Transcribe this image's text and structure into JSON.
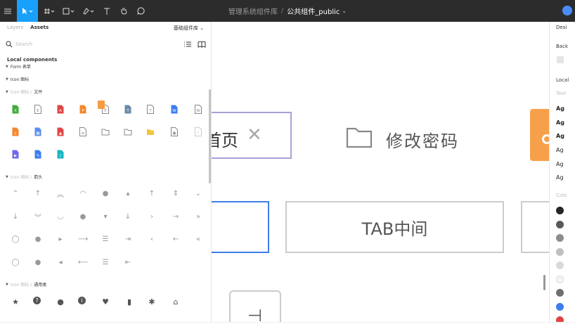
{
  "toolbar": {
    "file_path": "管理系统组件库",
    "separator": "/",
    "file_name": "公共组件_public",
    "file_chevron": "⌄",
    "tools": [
      "menu-icon",
      "move-icon",
      "frame-icon",
      "shape-icon",
      "pen-icon",
      "text-icon",
      "hand-icon",
      "comment-icon"
    ],
    "accent": "#18a0fb"
  },
  "left_panel": {
    "tabs": [
      "Layers",
      "Assets"
    ],
    "active_tab": "Assets",
    "library_selector": "基础组件库 ⌄",
    "search_placeholder": "Search",
    "section_title": "Local components",
    "groups": {
      "form": "Form 表单",
      "icon": "Icon 图标",
      "file_prefix": "Icon 图标 /",
      "file_name": "文件",
      "arrow_prefix": "Icon 图标 /",
      "arrow_name": "箭头",
      "common_prefix": "Icon 图标 /",
      "common_name": "通用类"
    },
    "file_icons": [
      {
        "name": "excel-file-icon",
        "color": "#3dae39",
        "letter": "X"
      },
      {
        "name": "generic-doc-file-icon",
        "color": "#888888",
        "letter": "E"
      },
      {
        "name": "pdf-file-icon",
        "color": "#e04545",
        "letter": "A"
      },
      {
        "name": "ppt-file-icon",
        "color": "#f5872d",
        "letter": "P"
      },
      {
        "name": "ppt-outline-file-icon",
        "color": "#888888",
        "letter": "P"
      },
      {
        "name": "text-file-icon",
        "color": "#6c8aa6",
        "letter": "T"
      },
      {
        "name": "text-outline-file-icon",
        "color": "#888888",
        "letter": "T"
      },
      {
        "name": "word-file-icon",
        "color": "#3c7ef0",
        "letter": "W"
      },
      {
        "name": "word-outline-file-icon",
        "color": "#888888",
        "letter": "W"
      },
      {
        "name": "download-file-icon",
        "color": "#f5872d",
        "letter": "↓"
      },
      {
        "name": "zip-file-icon",
        "color": "#5b8def",
        "letter": "▦"
      },
      {
        "name": "image-file-icon",
        "color": "#e04545",
        "letter": "▲"
      },
      {
        "name": "document-outline-icon",
        "color": "#888888",
        "letter": "≡"
      },
      {
        "name": "folder-outline-icon",
        "color": "#888888",
        "letter": ""
      },
      {
        "name": "folder-open-icon",
        "color": "#888888",
        "letter": ""
      },
      {
        "name": "folder-filled-icon",
        "color": "#f7c33d",
        "letter": ""
      },
      {
        "name": "image-outline-file-icon",
        "color": "#888888",
        "letter": "▣"
      },
      {
        "name": "unknown-file-icon",
        "color": "#cccccc",
        "letter": "?"
      },
      {
        "name": "video-file-icon",
        "color": "#6b6bf0",
        "letter": "▶"
      },
      {
        "name": "edit-file-icon",
        "color": "#3c7ef0",
        "letter": "✎"
      },
      {
        "name": "audio-file-icon",
        "color": "#16b6c4",
        "letter": "♪"
      }
    ],
    "arrow_icons": [
      [
        "chevron-up-icon",
        "arrow-up-icon",
        "double-chevron-up-icon",
        "circle-chevron-up-icon",
        "circle-filled-chevron-up-icon",
        "caret-up-icon",
        "line-arrow-up-icon",
        "sort-icon",
        "chevron-down-icon"
      ],
      [
        "arrow-down-icon",
        "double-chevron-down-icon",
        "circle-chevron-down-icon",
        "circle-filled-chevron-down-icon",
        "caret-down-icon",
        "line-arrow-down-icon",
        "chevron-right-icon",
        "arrow-right-icon",
        "double-chevron-right-icon"
      ],
      [
        "circle-chevron-right-icon",
        "circle-filled-chevron-right-icon",
        "caret-right-icon",
        "line-arrow-right-icon",
        "indent-icon",
        "list-arrow-right-icon",
        "chevron-left-icon",
        "arrow-left-icon",
        "double-chevron-left-icon"
      ],
      [
        "circle-chevron-left-icon",
        "circle-filled-chevron-left-icon",
        "caret-left-icon",
        "line-arrow-left-icon",
        "list-collapse-icon",
        "outdent-icon"
      ]
    ],
    "common_icons": [
      "star-icon",
      "help-circle-icon",
      "user-icon",
      "info-circle-icon",
      "heart-icon",
      "bar-chart-icon",
      "settings-icon",
      "home-icon"
    ]
  },
  "canvas": {
    "tab_home_label": "首页",
    "tab_home_close": "✕",
    "tab_password_label": "修改密码",
    "tab_middle_label": "TAB中间",
    "small_card_glyph": "⊣"
  },
  "right_panel": {
    "design_tab": "Desi",
    "background_label": "Back",
    "local_styles_label": "Local",
    "text_label": "Text",
    "text_styles": [
      "Ag",
      "Ag",
      "Ag",
      "Ag",
      "Ag",
      "Ag"
    ],
    "color_label": "Colo",
    "swatches": [
      "#262626",
      "#595959",
      "#8c8c8c",
      "#bfbfbf",
      "#d9d9d9",
      "#f5f5f5",
      "#6e6e73",
      "#3c7ef0",
      "#e04545"
    ]
  }
}
